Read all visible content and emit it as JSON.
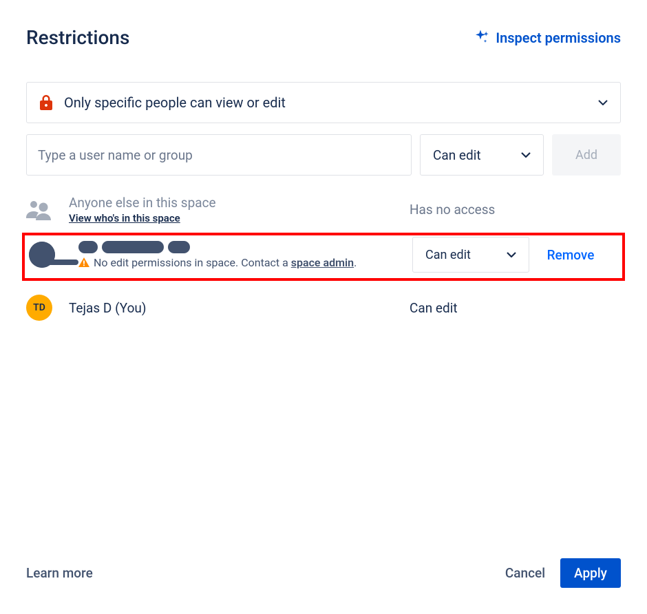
{
  "header": {
    "title": "Restrictions",
    "inspect_label": "Inspect permissions"
  },
  "restriction_select": {
    "label": "Only specific people can view or edit"
  },
  "add_row": {
    "placeholder": "Type a user name or group",
    "permission_label": "Can edit",
    "add_label": "Add"
  },
  "rows": {
    "anyone": {
      "title": "Anyone else in this space",
      "link": "View who's in this space",
      "permission": "Has no access"
    },
    "highlighted": {
      "warning_text": "No edit permissions in space. Contact a ",
      "space_admin": "space admin",
      "permission": "Can edit",
      "action": "Remove"
    },
    "current_user": {
      "initials": "TD",
      "name": "Tejas D (You)",
      "permission": "Can edit"
    }
  },
  "footer": {
    "learn_more": "Learn more",
    "cancel": "Cancel",
    "apply": "Apply"
  }
}
